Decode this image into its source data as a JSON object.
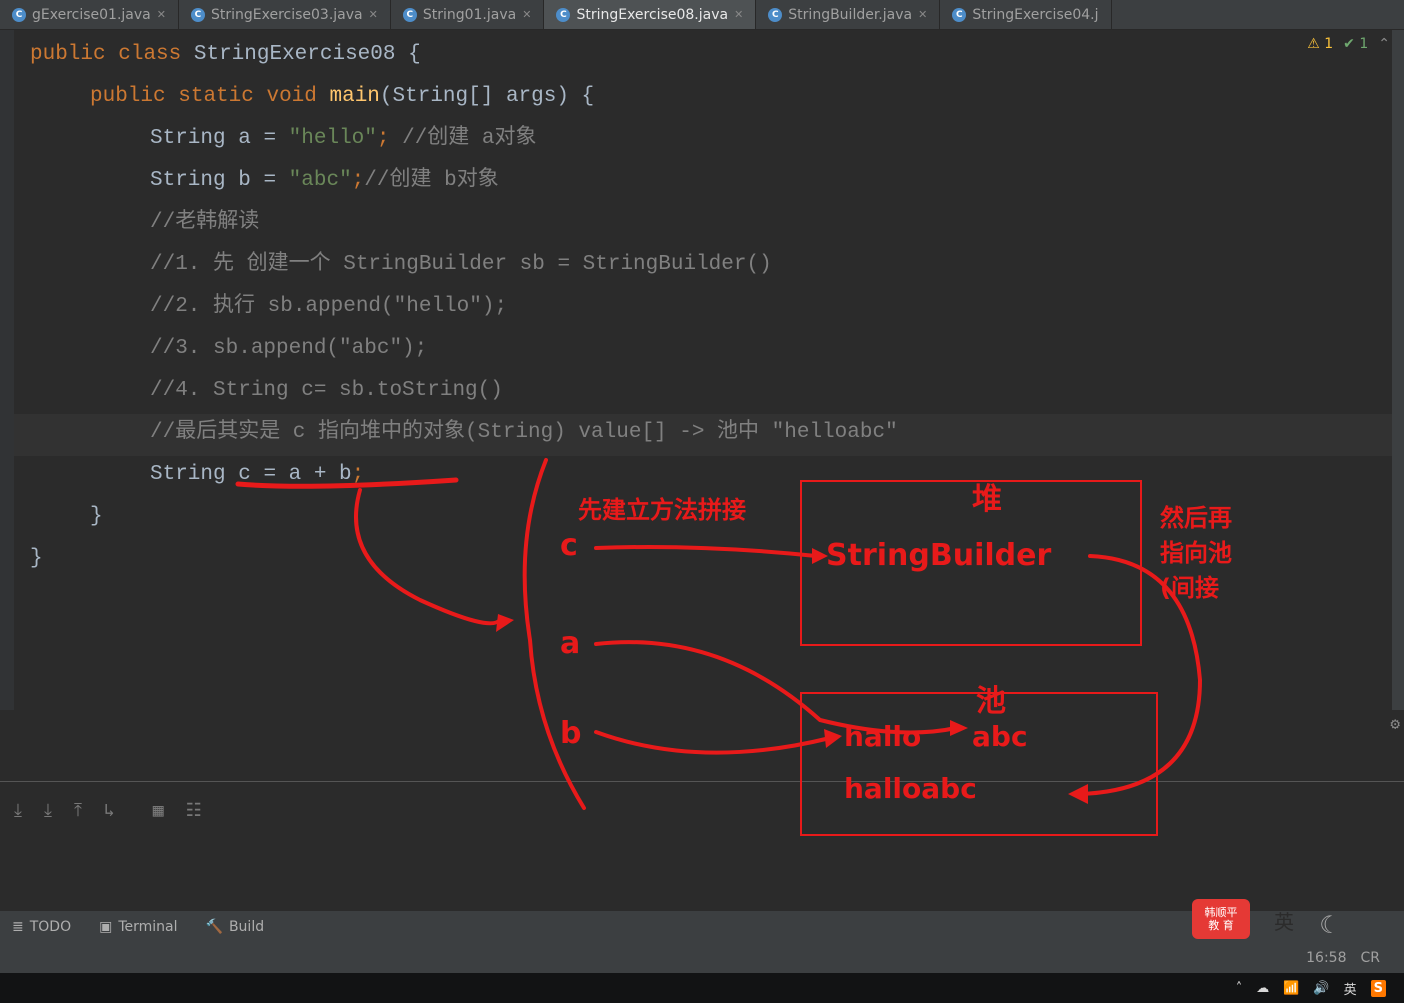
{
  "tabs": [
    {
      "label": "gExercise01.java"
    },
    {
      "label": "StringExercise03.java"
    },
    {
      "label": "String01.java"
    },
    {
      "label": "StringExercise08.java",
      "active": true
    },
    {
      "label": "StringBuilder.java"
    },
    {
      "label": "StringExercise04.j"
    }
  ],
  "indicators": {
    "warn": "1",
    "ok": "1"
  },
  "code": {
    "l1_kw1": "public",
    "l1_kw2": "class",
    "l1_name": "StringExercise08",
    "l1_brace": "{",
    "l2_kw1": "public",
    "l2_kw2": "static",
    "l2_kw3": "void",
    "l2_method": "main",
    "l2_params": "(String[] args) {",
    "l3_type": "String",
    "l3_var": "a =",
    "l3_str": "\"hello\"",
    "l3_semi": ";",
    "l3_comment": "//创建 a对象",
    "l4_type": "String",
    "l4_var": "b =",
    "l4_str": "\"abc\"",
    "l4_semi": ";",
    "l4_comment": "//创建 b对象",
    "l5_comment": "//老韩解读",
    "l6_comment": "//1. 先 创建一个 StringBuilder sb = StringBuilder()",
    "l7_comment": "//2. 执行  sb.append(\"hello\");",
    "l8_comment": "//3. sb.append(\"abc\");",
    "l9_comment": "//4. String c= sb.toString()",
    "l10_comment": "//最后其实是 c 指向堆中的对象(String) value[] -> 池中 \"helloabc\"",
    "l11_type": "String",
    "l11_var": "c = a + b",
    "l11_semi": ";",
    "l12_brace": "}",
    "l13_brace": "}"
  },
  "annotations": {
    "method_build": "先建立方法拼接",
    "heap": "堆",
    "pool": "池",
    "stringbuilder": "StringBuilder",
    "hallo": "hallo",
    "abc": "abc",
    "halloabc": "halloabc",
    "then_point": "然后再\n指向池\n(间接",
    "c": "c",
    "a": "a",
    "b": "b"
  },
  "bottom_panel": {
    "todo": "TODO",
    "terminal": "Terminal",
    "build": "Build"
  },
  "status_bar": {
    "time": "16:58",
    "sep": "CR"
  },
  "brand": {
    "line1": "韩顺平",
    "line2": "教 育"
  },
  "lang": "英",
  "taskbar_lang": "英"
}
